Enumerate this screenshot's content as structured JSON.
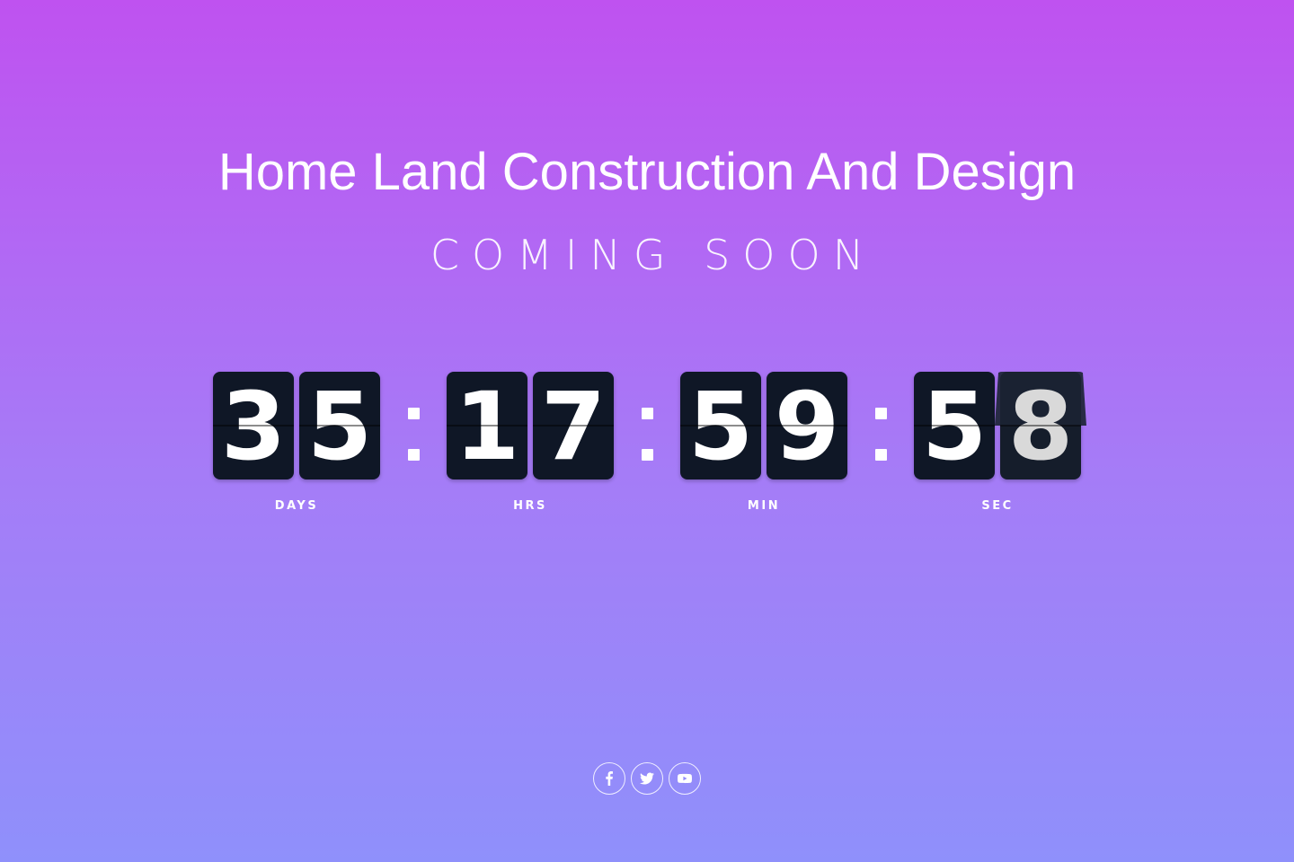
{
  "header": {
    "title": "Home Land Construction And Design",
    "subtitle": "COMING SOON"
  },
  "countdown": {
    "days": {
      "digits": [
        "3",
        "5"
      ],
      "label": "DAYS"
    },
    "hours": {
      "digits": [
        "1",
        "7"
      ],
      "label": "HRS"
    },
    "minutes": {
      "digits": [
        "5",
        "9"
      ],
      "label": "MIN"
    },
    "seconds": {
      "digits": [
        "5",
        "8"
      ],
      "label": "SEC"
    },
    "separator": ":"
  },
  "social": {
    "links": [
      {
        "icon": "facebook-icon"
      },
      {
        "icon": "twitter-icon"
      },
      {
        "icon": "youtube-icon"
      }
    ]
  },
  "colors": {
    "gradient_top": "#bf52f0",
    "gradient_bottom": "#8f90fb",
    "tile": "#0f1726",
    "text": "#ffffff"
  }
}
